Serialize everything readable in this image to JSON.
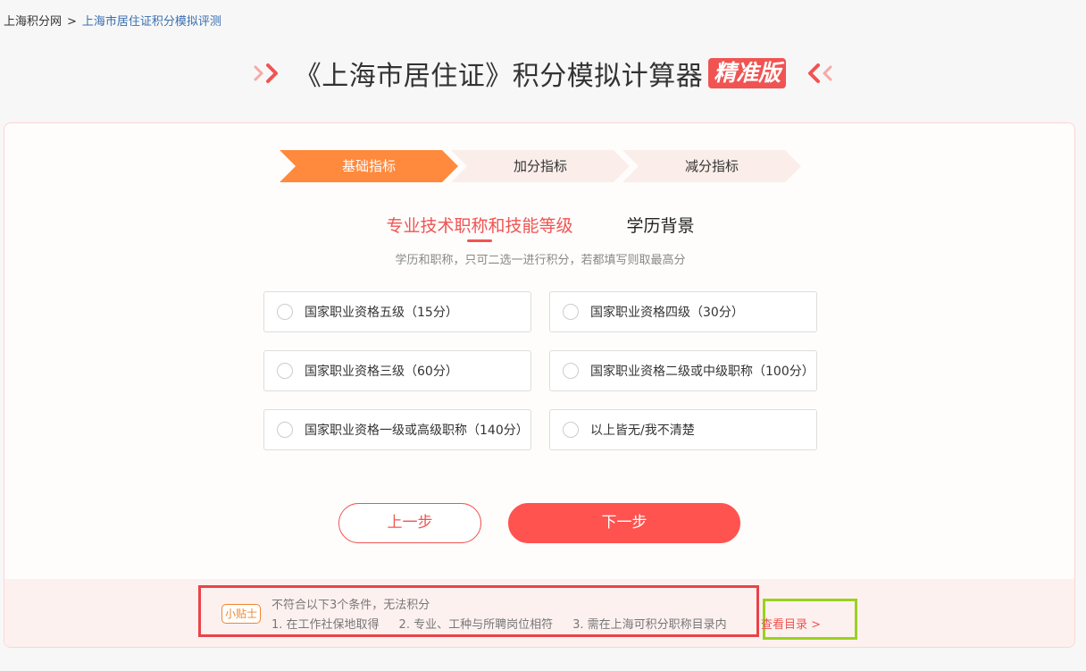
{
  "breadcrumb": {
    "home": "上海积分网",
    "separator": ">",
    "current": "上海市居住证积分模拟评测"
  },
  "header": {
    "title": "《上海市居住证》积分模拟计算器",
    "badge": "精准版"
  },
  "steps": [
    {
      "label": "基础指标",
      "active": true
    },
    {
      "label": "加分指标",
      "active": false
    },
    {
      "label": "减分指标",
      "active": false
    }
  ],
  "tabs": [
    {
      "label": "专业技术职称和技能等级",
      "active": true
    },
    {
      "label": "学历背景",
      "active": false
    }
  ],
  "hint": "学历和职称，只可二选一进行积分，若都填写则取最高分",
  "options": [
    "国家职业资格五级（15分）",
    "国家职业资格四级（30分）",
    "国家职业资格三级（60分）",
    "国家职业资格二级或中级职称（100分）",
    "国家职业资格一级或高级职称（140分）",
    "以上皆无/我不清楚"
  ],
  "buttons": {
    "prev": "上一步",
    "next": "下一步"
  },
  "tips": {
    "badge": "小贴士",
    "title": "不符合以下3个条件，无法积分",
    "items": [
      "1. 在工作社保地取得",
      "2. 专业、工种与所聘岗位相符",
      "3. 需在上海可积分职称目录内"
    ],
    "link": "查看目录 >"
  },
  "colors": {
    "accent": "#f05452",
    "step_active": "#ff8a3d",
    "tips_border": "#e9434a",
    "link_box_border": "#9bd11e"
  }
}
